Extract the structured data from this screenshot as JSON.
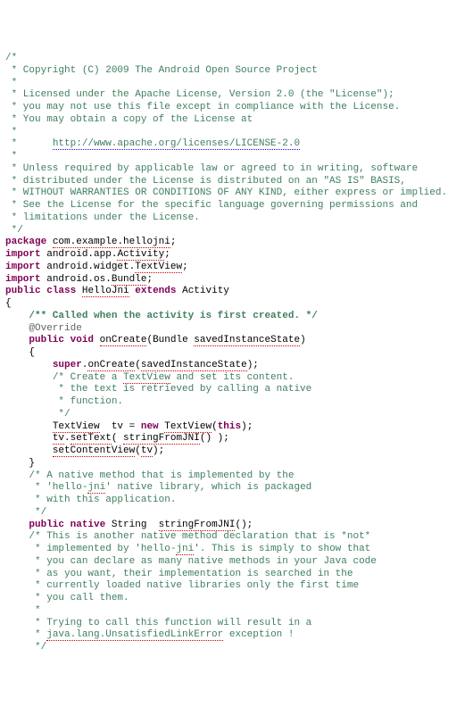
{
  "lic": {
    "l01": "/*",
    "l02": " * Copyright (C) 2009 The Android Open Source Project",
    "l03": " *",
    "l04": " * Licensed under the Apache License, Version 2.0 (the \"License\");",
    "l05": " * you may not use this file except in compliance with the License.",
    "l06": " * You may obtain a copy of the License at",
    "l07": " *",
    "l08a": " *      ",
    "l08b": "http://www.apache.org/licenses/LICENSE-2.0",
    "l09": " *",
    "l10": " * Unless required by applicable law or agreed to in writing, software",
    "l11": " * distributed under the License is distributed on an \"AS IS\" BASIS,",
    "l12": " * WITHOUT WARRANTIES OR CONDITIONS OF ANY KIND, either express or implied.",
    "l13": " * See the License for the specific language governing permissions and",
    "l14": " * limitations under the License.",
    "l15": " */"
  },
  "pkg": {
    "kw": "package",
    "sp": " ",
    "name": "com.example.hellojni",
    "end": ";"
  },
  "imp1": {
    "kw": "import",
    "sp": " ",
    "pfx": "android.app.",
    "cls": "Activity",
    "end": ";"
  },
  "imp2": {
    "kw": "import",
    "sp": " ",
    "pfx": "android.widget.",
    "cls": "TextView",
    "end": ";"
  },
  "imp3": {
    "kw": "import",
    "sp": " ",
    "pfx": "android.os.",
    "cls": "Bundle",
    "end": ";"
  },
  "cls": {
    "kw1": "public",
    "kw2": "class",
    "name": "HelloJni",
    "kw3": "extends",
    "sup": "Activity",
    "sp": " "
  },
  "brace_open": "{",
  "brace_close": "}",
  "doc_call": "/** Called when the activity is first created. */",
  "override": "@Override",
  "m_oncreate": {
    "kw1": "public",
    "kw2": "void",
    "name": "onCreate",
    "lp": "(",
    "ptype": "Bundle",
    "pname": "savedInstanceState",
    "rp": ")",
    "sp": " "
  },
  "body": {
    "b1a": "super",
    "b1b": ".",
    "b1c": "onCreate",
    "b1d": "(",
    "b1e": "savedInstanceState",
    "b1f": ");",
    "c1": "/* Create a ",
    "c1b": "TextView",
    "c1c": " and set its content.",
    "c2": " * the text is retrieved by calling a native",
    "c3": " * function.",
    "c4": " */",
    "tv1": "TextView",
    "tv2": "  tv = ",
    "tv3": "new",
    "tv4": " ",
    "tv5": "TextView",
    "tv6": "(",
    "tv7": "this",
    "tv8": ");",
    "st1": "tv",
    "st2": ".",
    "st3": "setText",
    "st4": "( ",
    "st5": "stringFromJNI",
    "st6": "() );",
    "sc1": "setContentView",
    "sc2": "(",
    "sc3": "tv",
    "sc4": ");"
  },
  "ncom": {
    "n1": "/* A native method that is implemented by the",
    "n2": " * 'hello-",
    "n2b": "jni",
    "n2c": "' native library, which is packaged",
    "n3": " * with this application.",
    "n4": " */"
  },
  "m_native": {
    "kw1": "public",
    "kw2": "native",
    "ret": "String",
    "sp2": "  ",
    "name": "stringFromJNI",
    "paren": "();",
    "sp": " "
  },
  "ncom2": {
    "a1": "/* This is another native method declaration that is *not*",
    "a2": " * implemented by 'hello-",
    "a2b": "jni",
    "a2c": "'. This is simply to show that",
    "a3": " * you can declare as many native methods in your Java code",
    "a4": " * as you want, their implementation is searched in the",
    "a5": " * currently loaded native libraries only the first time",
    "a6": " * you call them.",
    "a7": " *",
    "a8": " * Trying to call this function will result in a",
    "a9a": " * ",
    "a9b": "java.lang.UnsatisfiedLinkError",
    "a9c": " exception !",
    "a10": " */"
  },
  "ind": {
    "i1": "    ",
    "i2": "        "
  }
}
